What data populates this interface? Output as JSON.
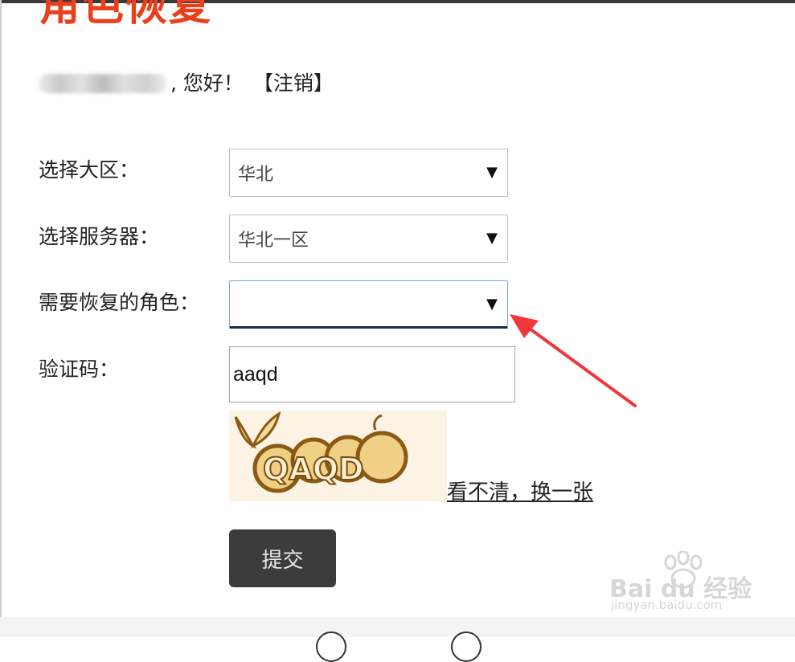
{
  "page": {
    "title": "角色恢复"
  },
  "greeting": {
    "text": ", 您好！",
    "logout_label": "【注销】"
  },
  "form": {
    "region_label": "选择大区：",
    "region_value": "华北",
    "server_label": "选择服务器：",
    "server_value": "华北一区",
    "role_label": "需要恢复的角色：",
    "role_value": "",
    "captcha_label": "验证码：",
    "captcha_value": "aaqd",
    "captcha_image_text": "QAQD",
    "refresh_link": "看不清，换一张",
    "submit_label": "提交"
  },
  "watermark": {
    "brand": "Bai du 经验",
    "url": "jingyan.baidu.com"
  },
  "colors": {
    "title": "#e8401c",
    "arrow": "#f0373a",
    "button": "#3d3c3c"
  },
  "icons": [
    "dropdown-caret-icon",
    "red-arrow-annotation",
    "baidu-paw-icon"
  ]
}
